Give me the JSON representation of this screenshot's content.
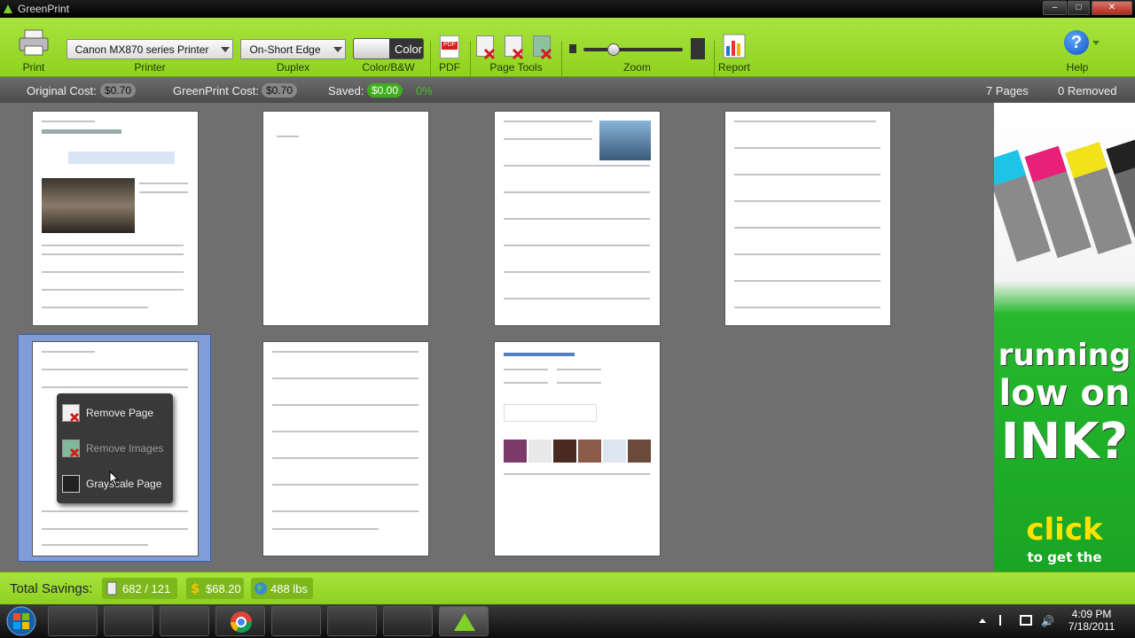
{
  "window": {
    "title": "GreenPrint"
  },
  "toolbar": {
    "print_label": "Print",
    "printer_value": "Canon MX870 series Printer",
    "printer_label": "Printer",
    "duplex_value": "On-Short Edge",
    "duplex_label": "Duplex",
    "color_value": "Color",
    "color_label": "Color/B&W",
    "pdf_label": "PDF",
    "pdf_icon_text": "PDF",
    "page_tools_label": "Page Tools",
    "zoom_label": "Zoom",
    "zoom_level": 0.3,
    "report_label": "Report",
    "help_label": "Help",
    "help_icon_text": "?"
  },
  "costbar": {
    "original_cost_label": "Original Cost:",
    "original_cost_value": "$0.70",
    "greenprint_cost_label": "GreenPrint Cost:",
    "greenprint_cost_value": "$0.70",
    "saved_label": "Saved:",
    "saved_value": "$0.00",
    "saved_percent": "0%",
    "pages_count": "7 Pages",
    "removed_count": "0 Removed"
  },
  "context_menu": {
    "items": [
      {
        "label": "Remove Page",
        "enabled": true
      },
      {
        "label": "Remove Images",
        "enabled": false
      },
      {
        "label": "Grayscale Page",
        "enabled": true
      }
    ]
  },
  "ad": {
    "line1": "running",
    "line2": "low on",
    "line3": "INK?",
    "click": "click",
    "sub": "to get the"
  },
  "savings": {
    "label": "Total Savings:",
    "pages": "682 / 121",
    "money": "$68.20",
    "co2": "488 lbs"
  },
  "taskbar": {
    "time": "4:09 PM",
    "date": "7/18/2011"
  },
  "colors": {
    "toolbar_green": "#a8e43e",
    "saved_green": "#3fae1d",
    "selection_blue": "#7e9dd9"
  }
}
